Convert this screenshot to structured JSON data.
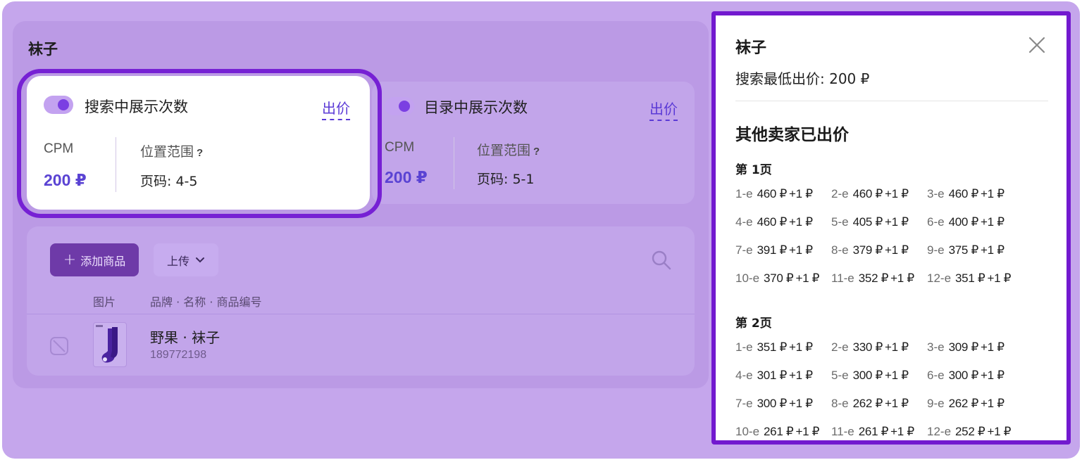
{
  "section_title": "袜子",
  "search_card": {
    "label": "搜索中展示次数",
    "bid_link": "出价",
    "cpm_label": "CPM",
    "cpm_value": "200 ₽",
    "position_label": "位置范围",
    "position_help": "?",
    "position_value": "页码: 4-5"
  },
  "catalog_card": {
    "label": "目录中展示次数",
    "bid_link": "出价",
    "cpm_label": "CPM",
    "cpm_value": "200 ₽",
    "position_label": "位置范围",
    "position_help": "?",
    "position_value": "页码: 5-1"
  },
  "products": {
    "add_button": "添加商品",
    "upload_button": "上传",
    "columns": [
      "图片",
      "品牌 · 名称 · 商品编号"
    ],
    "rows": [
      {
        "name": "野果 · 袜子",
        "id": "189772198"
      }
    ]
  },
  "drawer": {
    "title": "袜子",
    "min_bid": "搜索最低出价: 200 ₽",
    "others_title": "其他卖家已出价",
    "pages": [
      {
        "label": "第 1页",
        "bids": [
          {
            "pos": "1-e",
            "amount": "460 ₽",
            "inc": "+1 ₽"
          },
          {
            "pos": "2-e",
            "amount": "460 ₽",
            "inc": "+1 ₽"
          },
          {
            "pos": "3-e",
            "amount": "460 ₽",
            "inc": "+1 ₽"
          },
          {
            "pos": "4-e",
            "amount": "460 ₽",
            "inc": "+1 ₽"
          },
          {
            "pos": "5-e",
            "amount": "405 ₽",
            "inc": "+1 ₽"
          },
          {
            "pos": "6-e",
            "amount": "400 ₽",
            "inc": "+1 ₽"
          },
          {
            "pos": "7-e",
            "amount": "391 ₽",
            "inc": "+1 ₽"
          },
          {
            "pos": "8-e",
            "amount": "379 ₽",
            "inc": "+1 ₽"
          },
          {
            "pos": "9-e",
            "amount": "375 ₽",
            "inc": "+1 ₽"
          },
          {
            "pos": "10-e",
            "amount": "370 ₽",
            "inc": "+1 ₽"
          },
          {
            "pos": "11-e",
            "amount": "352 ₽",
            "inc": "+1 ₽"
          },
          {
            "pos": "12-e",
            "amount": "351 ₽",
            "inc": "+1 ₽"
          }
        ]
      },
      {
        "label": "第 2页",
        "bids": [
          {
            "pos": "1-e",
            "amount": "351 ₽",
            "inc": "+1 ₽"
          },
          {
            "pos": "2-e",
            "amount": "330 ₽",
            "inc": "+1 ₽"
          },
          {
            "pos": "3-e",
            "amount": "309 ₽",
            "inc": "+1 ₽"
          },
          {
            "pos": "4-e",
            "amount": "301 ₽",
            "inc": "+1 ₽"
          },
          {
            "pos": "5-e",
            "amount": "300 ₽",
            "inc": "+1 ₽"
          },
          {
            "pos": "6-e",
            "amount": "300 ₽",
            "inc": "+1 ₽"
          },
          {
            "pos": "7-e",
            "amount": "300 ₽",
            "inc": "+1 ₽"
          },
          {
            "pos": "8-e",
            "amount": "262 ₽",
            "inc": "+1 ₽"
          },
          {
            "pos": "9-e",
            "amount": "262 ₽",
            "inc": "+1 ₽"
          },
          {
            "pos": "10-e",
            "amount": "261 ₽",
            "inc": "+1 ₽"
          },
          {
            "pos": "11-e",
            "amount": "261 ₽",
            "inc": "+1 ₽"
          },
          {
            "pos": "12-e",
            "amount": "252 ₽",
            "inc": "+1 ₽"
          }
        ]
      }
    ]
  },
  "colors": {
    "overlay": "#c5a6ec",
    "highlight_outline": "#7620d4",
    "accent": "#5b3ad6",
    "primary_button": "#6e3aa8"
  },
  "icons": {
    "close": "close-icon",
    "search": "search-icon",
    "chevron": "chevron-down-icon",
    "plus": "plus-icon",
    "checkbox": "checkbox-disabled-icon"
  }
}
